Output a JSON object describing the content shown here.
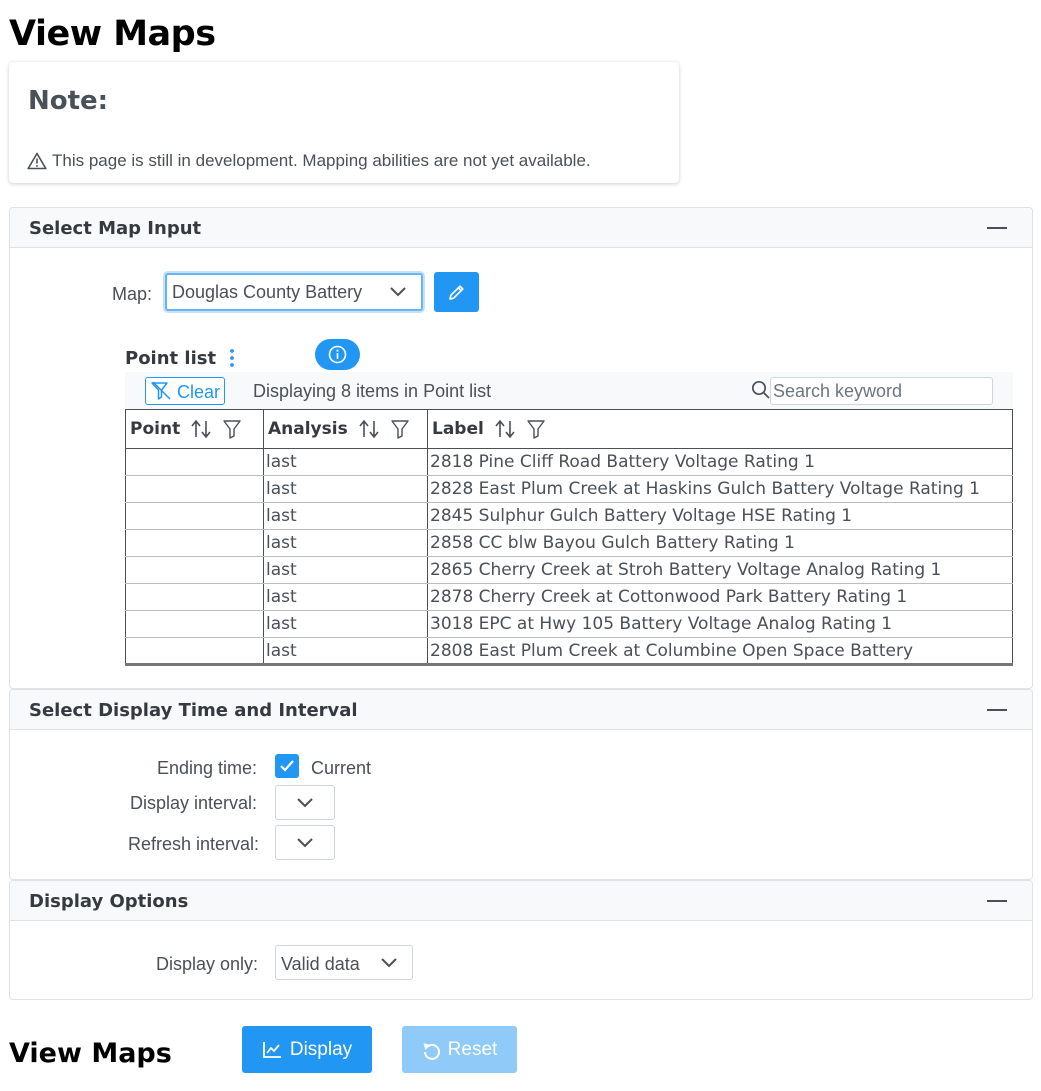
{
  "page_title": "View Maps",
  "note": {
    "title": "Note:",
    "icon": "warning-icon",
    "message": "This page is still in development. Mapping abilities are not yet available."
  },
  "map_input": {
    "title": "Select Map Input",
    "map_label": "Map:",
    "map_value": "Douglas County Battery",
    "point_list": {
      "title": "Point list",
      "clear_label": "Clear",
      "count_text": "Displaying 8 items in Point list",
      "search_placeholder": "Search keyword",
      "columns": [
        "Point",
        "Analysis",
        "Label"
      ],
      "rows": [
        {
          "point": "",
          "analysis": "last",
          "label": "2818 Pine Cliff Road Battery Voltage Rating 1"
        },
        {
          "point": "",
          "analysis": "last",
          "label": "2828 East Plum Creek at Haskins Gulch Battery Voltage Rating 1"
        },
        {
          "point": "",
          "analysis": "last",
          "label": "2845 Sulphur Gulch Battery Voltage HSE Rating 1"
        },
        {
          "point": "",
          "analysis": "last",
          "label": "2858 CC blw Bayou Gulch Battery Rating 1"
        },
        {
          "point": "",
          "analysis": "last",
          "label": "2865 Cherry Creek at Stroh Battery Voltage Analog Rating 1"
        },
        {
          "point": "",
          "analysis": "last",
          "label": "2878 Cherry Creek at Cottonwood Park Battery Rating 1"
        },
        {
          "point": "",
          "analysis": "last",
          "label": "3018 EPC at Hwy 105 Battery Voltage Analog Rating 1"
        },
        {
          "point": "",
          "analysis": "last",
          "label": "2808 East Plum Creek at Columbine Open Space Battery"
        }
      ]
    }
  },
  "time_interval": {
    "title": "Select Display Time and Interval",
    "ending_time_label": "Ending time:",
    "current_label": "Current",
    "current_checked": true,
    "display_interval_label": "Display interval:",
    "refresh_interval_label": "Refresh interval:"
  },
  "display_options": {
    "title": "Display Options",
    "display_only_label": "Display only:",
    "display_only_value": "Valid data"
  },
  "footer": {
    "title": "View Maps",
    "display_label": "Display",
    "reset_label": "Reset"
  },
  "colors": {
    "primary": "#2196f3",
    "primary_disabled": "#90caf9",
    "text": "#495057",
    "panel_header_bg": "#f8f9fa"
  }
}
